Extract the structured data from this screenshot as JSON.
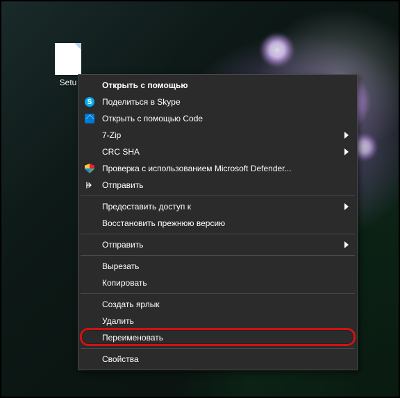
{
  "desktop": {
    "file_label": "Setu"
  },
  "context_menu": {
    "open_with": "Открыть с помощью",
    "skype_share": "Поделиться в Skype",
    "open_with_code": "Открыть с помощью Code",
    "seven_zip": "7-Zip",
    "crc_sha": "CRC SHA",
    "defender_scan": "Проверка с использованием Microsoft Defender...",
    "send": "Отправить",
    "give_access": "Предоставить доступ к",
    "restore_prev": "Восстановить прежнюю версию",
    "send_to": "Отправить",
    "cut": "Вырезать",
    "copy": "Копировать",
    "create_shortcut": "Создать ярлык",
    "delete": "Удалить",
    "rename": "Переименовать",
    "properties": "Свойства"
  },
  "highlight": {
    "target": "rename",
    "color": "#d11212"
  }
}
